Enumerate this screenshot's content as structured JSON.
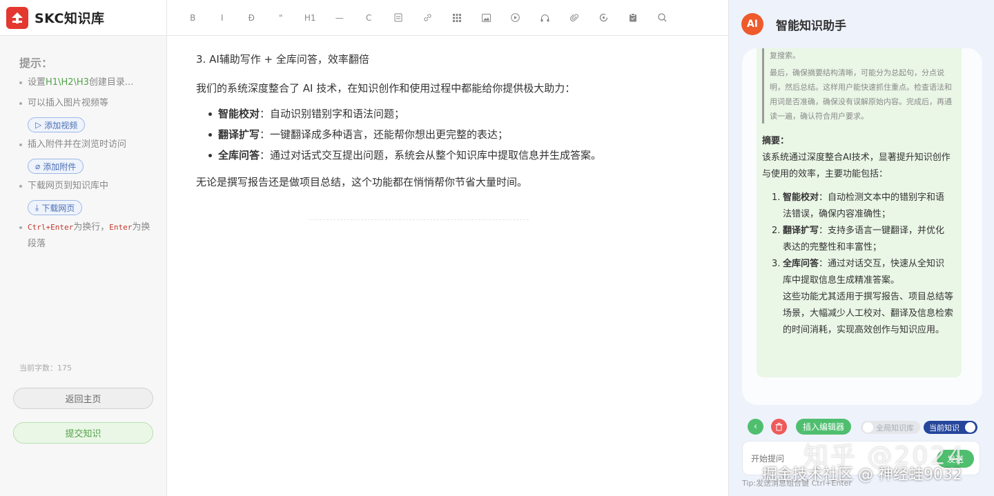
{
  "app": {
    "logo_text": "SKC知识库"
  },
  "sidebar": {
    "tips_title": "提示：",
    "tip1_prefix": "设置",
    "tip1_highlight": "H1\\H2\\H3",
    "tip1_suffix": "创建目录...",
    "tip2": "可以插入图片视频等",
    "add_video": "添加视频",
    "tip3": "插入附件并在浏览时访问",
    "add_attachment": "添加附件",
    "tip4": "下载网页到知识库中",
    "download_page": "下载网页",
    "tip5_code1": "Ctrl+Enter",
    "tip5_text1": "为换行，",
    "tip5_code2": "Enter",
    "tip5_text2": "为换段落",
    "word_count": "当前字数：175",
    "home_button": "返回主页",
    "submit_button": "提交知识"
  },
  "toolbar": {
    "bold": "B",
    "italic": "I",
    "strike": "Đ",
    "quote": "\"",
    "h1": "H1",
    "hr": "—",
    "code": "C"
  },
  "editor": {
    "heading": "3. AI辅助写作 + 全库问答，效率翻倍",
    "intro": "我们的系统深度整合了 AI 技术，在知识创作和使用过程中都能给你提供极大助力：",
    "items": [
      {
        "title": "智能校对",
        "text": "：自动识别错别字和语法问题；"
      },
      {
        "title": "翻译扩写",
        "text": "：一键翻译成多种语言，还能帮你想出更完整的表达；"
      },
      {
        "title": "全库问答",
        "text": "：通过对话式交互提出问题，系统会从整个知识库中提取信息并生成答案。"
      }
    ],
    "outro": "无论是撰写报告还是做项目总结，这个功能都在悄悄帮你节省大量时间。"
  },
  "assistant": {
    "badge": "AI",
    "title": "智能知识助手",
    "quote_line1": "复搜索。",
    "quote_line2": "最后，确保摘要结构清晰，可能分为总起句，分点说明，然后总结。这样用户能快速抓住重点。检查语法和用词是否准确，确保没有误解原始内容。完成后，再通读一遍，确认符合用户要求。",
    "summary_label": "摘要：",
    "summary_text": "该系统通过深度整合AI技术，显著提升知识创作与使用的效率，主要功能包括：",
    "points": [
      {
        "num": "1.",
        "title": "智能校对",
        "text": "：自动检测文本中的错别字和语法错误，确保内容准确性；"
      },
      {
        "num": "2.",
        "title": "翻译扩写",
        "text": "：支持多语言一键翻译，并优化表达的完整性和丰富性；"
      },
      {
        "num": "3.",
        "title": "全库问答",
        "text": "：通过对话交互，快速从全知识库中提取信息生成精准答案。"
      }
    ],
    "closing": "这些功能尤其适用于撰写报告、项目总结等场景，大幅减少人工校对、翻译及信息检索的时间消耗，实现高效创作与知识应用。",
    "insert_button": "插入编辑器",
    "toggle_all": "全局知识库",
    "toggle_current": "当前知识",
    "input_placeholder": "开始提问",
    "send_button": "发送",
    "tip": "Tip:发送消息组合键 Ctrl+Enter"
  },
  "overlay": {
    "watermark": "知乎 @2024",
    "watermark2": "掘金技术社区 @ 神经蛙9032"
  }
}
